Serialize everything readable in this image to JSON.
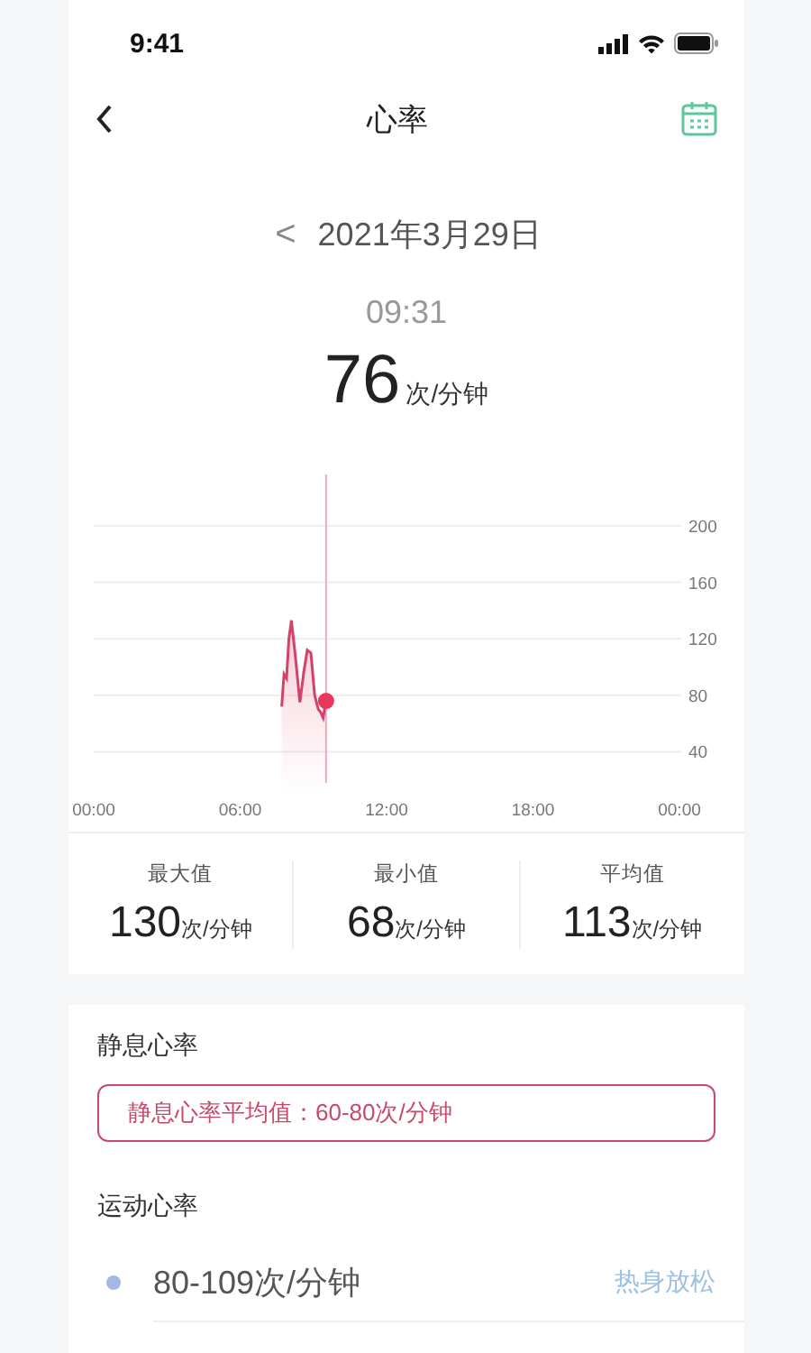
{
  "status_bar": {
    "time": "9:41"
  },
  "nav": {
    "title": "心率"
  },
  "date": {
    "back": "<",
    "text": "2021年3月29日"
  },
  "reading": {
    "time": "09:31",
    "value": "76",
    "unit": "次/分钟"
  },
  "chart": {
    "chart_data": {
      "type": "area",
      "grid": true,
      "x": [
        7.7,
        7.8,
        7.9,
        8.0,
        8.1,
        8.25,
        8.45,
        8.6,
        8.75,
        8.9,
        9.05,
        9.2,
        9.3,
        9.4,
        9.52
      ],
      "series": [
        {
          "color": "#d2436a",
          "values": [
            72,
            95,
            92,
            120,
            133,
            110,
            75,
            96,
            112,
            110,
            80,
            70,
            68,
            64,
            76
          ]
        }
      ],
      "xlim": [
        0,
        24
      ],
      "ylim": [
        40,
        200
      ],
      "ref_lines": [
        {
          "axis": "x",
          "value": 9.52
        }
      ],
      "xticks": [
        {
          "value": 0,
          "label": "00:00"
        },
        {
          "value": 6,
          "label": "06:00"
        },
        {
          "value": 12,
          "label": "12:00"
        },
        {
          "value": 18,
          "label": "18:00"
        },
        {
          "value": 24,
          "label": "00:00"
        }
      ],
      "yticks": [
        40,
        80,
        120,
        160,
        200
      ]
    }
  },
  "stats": [
    {
      "label": "最大值",
      "value": "130",
      "unit": "次/分钟"
    },
    {
      "label": "最小值",
      "value": "68",
      "unit": "次/分钟"
    },
    {
      "label": "平均值",
      "value": "113",
      "unit": "次/分钟"
    }
  ],
  "resting": {
    "title": "静息心率",
    "note": "静息心率平均值：60-80次/分钟"
  },
  "exercise": {
    "title": "运动心率",
    "zones": [
      {
        "range": "80-109次/分钟",
        "label": "热身放松",
        "color": "#a3b9e3"
      }
    ]
  }
}
